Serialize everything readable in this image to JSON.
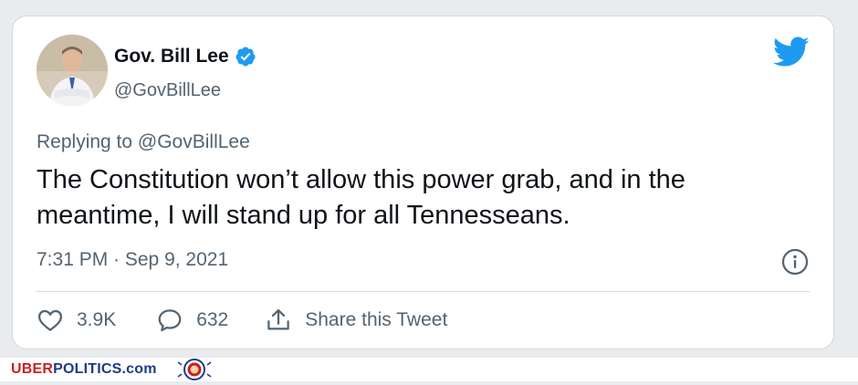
{
  "tweet": {
    "author_name": "Gov. Bill Lee",
    "author_handle": "@GovBillLee",
    "verified": true,
    "replying_to": "Replying to @GovBillLee",
    "text": "The Constitution won’t allow this power grab, and in the meantime, I will stand up for all Tennesseans.",
    "timestamp": "7:31 PM · Sep 9, 2021",
    "actions": {
      "like_count": "3.9K",
      "reply_count": "632",
      "share_label": "Share this Tweet"
    }
  },
  "icons": {
    "brand": "twitter-bird-icon",
    "verified": "verified-badge-icon",
    "info": "info-icon",
    "like": "heart-icon",
    "reply": "speech-bubble-icon",
    "share": "share-upload-icon"
  },
  "colors": {
    "twitter_blue": "#1d9bf0",
    "text_primary": "#0f1419",
    "text_secondary": "#536471",
    "border": "#cfd9de"
  },
  "watermark": {
    "brand_part1": "UBER",
    "brand_part2": "POLITICS",
    "brand_part3": ".com"
  }
}
